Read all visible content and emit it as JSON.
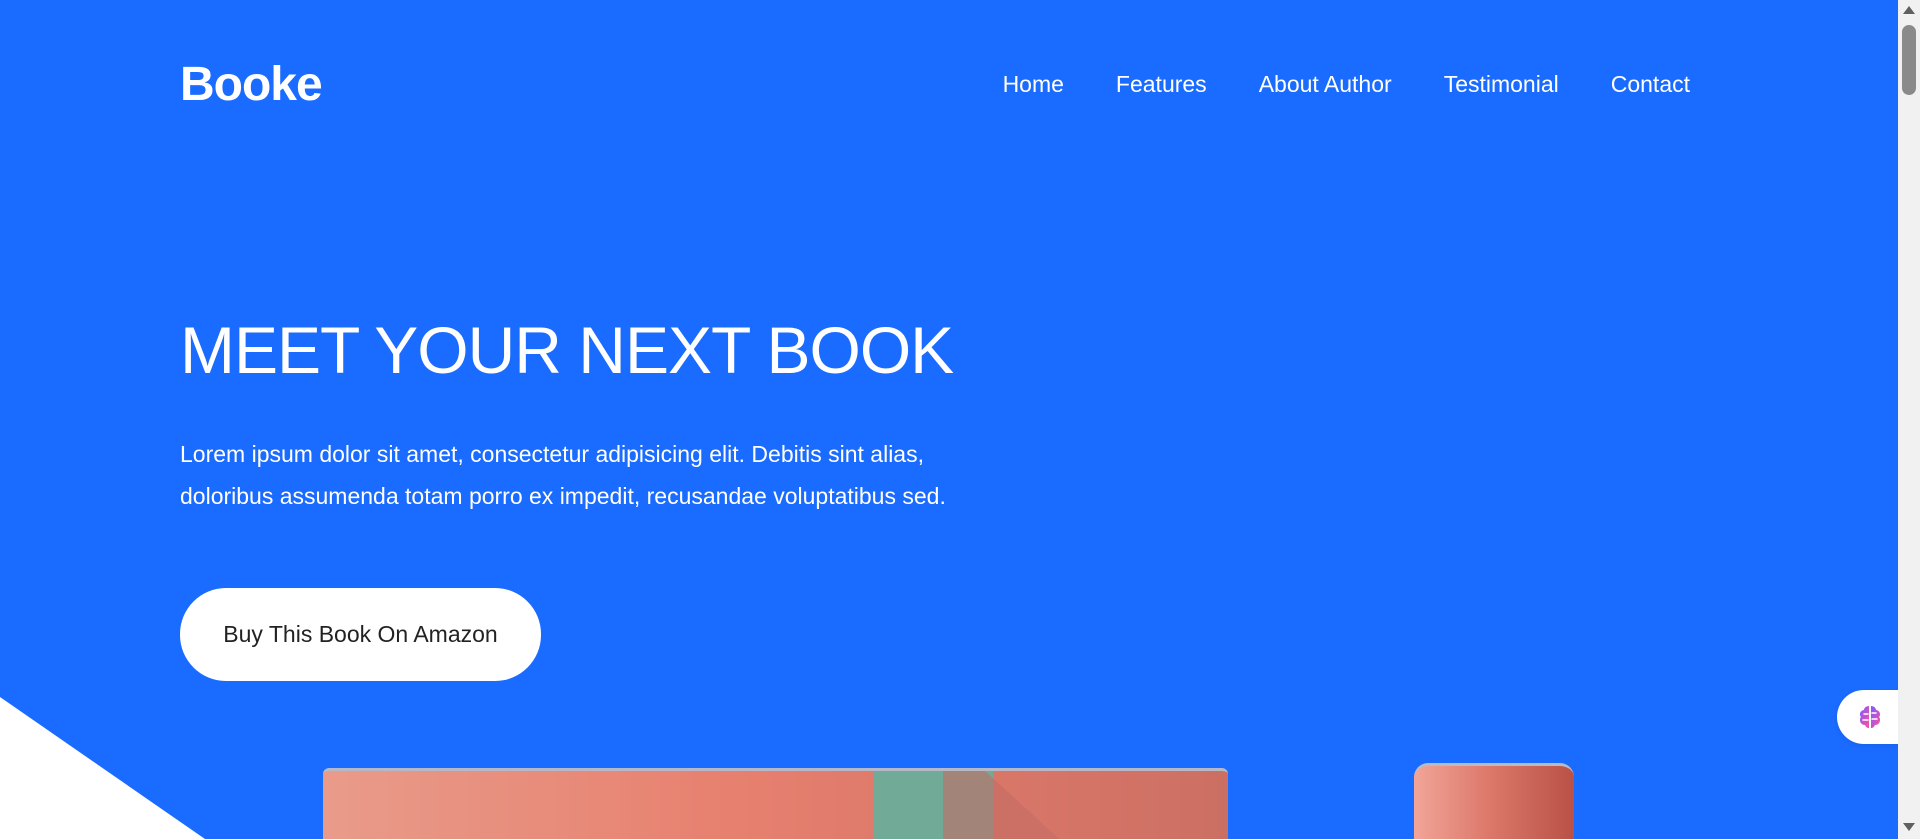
{
  "header": {
    "brand": "Booke",
    "nav": [
      {
        "label": "Home"
      },
      {
        "label": "Features"
      },
      {
        "label": "About Author"
      },
      {
        "label": "Testimonial"
      },
      {
        "label": "Contact"
      }
    ]
  },
  "hero": {
    "title": "MEET YOUR NEXT BOOK",
    "description": "Lorem ipsum dolor sit amet, consectetur adipisicing elit. Debitis sint alias, doloribus assumenda totam porro ex impedit, recusandae voluptatibus sed.",
    "cta_label": "Buy This Book On Amazon"
  },
  "icons": {
    "chat_widget": "brain-icon"
  },
  "colors": {
    "background": "#1a6bff",
    "button": "#ffffff",
    "book_primary": "#e7806f",
    "book_accent": "#72aa98"
  }
}
